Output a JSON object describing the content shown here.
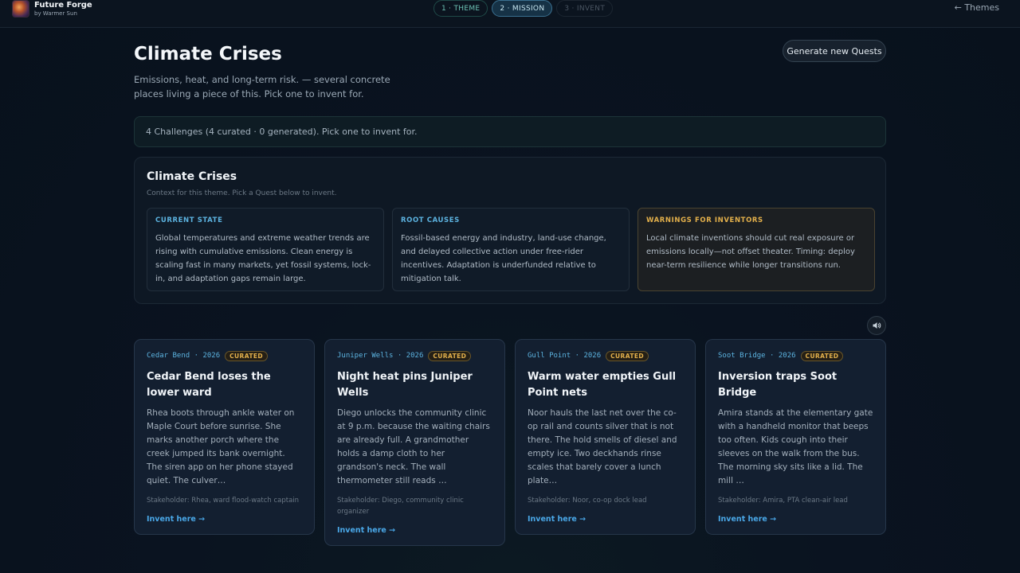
{
  "brand": {
    "title": "Future Forge",
    "subtitle": "by Warmer Sun"
  },
  "steps": [
    {
      "label": "1 · THEME",
      "state": "done"
    },
    {
      "label": "2 · MISSION",
      "state": "active"
    },
    {
      "label": "3 · INVENT",
      "state": "future"
    }
  ],
  "back_label": "← Themes",
  "header": {
    "title": "Climate Crises",
    "description": "Emissions, heat, and long-term risk. — several concrete places living a piece of this. Pick one to invent for.",
    "generate_label": "Generate new Quests"
  },
  "info_bar": "4 Challenges (4 curated · 0 generated). Pick one to invent for.",
  "context": {
    "title": "Climate Crises",
    "subtitle": "Context for this theme. Pick a Quest below to invent.",
    "cards": [
      {
        "label": "CURRENT STATE",
        "text": "Global temperatures and extreme weather trends are rising with cumulative emissions. Clean energy is scaling fast in many markets, yet fossil systems, lock-in, and adaptation gaps remain large."
      },
      {
        "label": "ROOT CAUSES",
        "text": "Fossil-based energy and industry, land-use change, and delayed collective action under free-rider incentives. Adaptation is underfunded relative to mitigation talk."
      },
      {
        "label": "WARNINGS FOR INVENTORS",
        "text": "Local climate inventions should cut real exposure or emissions locally—not offset theater. Timing: deploy near-term resilience while longer transitions run."
      }
    ]
  },
  "quests": [
    {
      "location": "Cedar Bend · 2026",
      "badge": "CURATED",
      "title": "Cedar Bend loses the lower ward",
      "body": "Rhea boots through ankle water on Maple Court before sunrise. She marks another porch where the creek jumped its bank overnight. The siren app on her phone stayed quiet. The culver…",
      "stakeholder": "Stakeholder: Rhea, ward flood-watch captain",
      "link": "Invent here →"
    },
    {
      "location": "Juniper Wells · 2026",
      "badge": "CURATED",
      "title": "Night heat pins Juniper Wells",
      "body": "Diego unlocks the community clinic at 9 p.m. because the waiting chairs are already full. A grandmother holds a damp cloth to her grandson's neck. The wall thermometer still reads …",
      "stakeholder": "Stakeholder: Diego, community clinic organizer",
      "link": "Invent here →"
    },
    {
      "location": "Gull Point · 2026",
      "badge": "CURATED",
      "title": "Warm water empties Gull Point nets",
      "body": "Noor hauls the last net over the co-op rail and counts silver that is not there. The hold smells of diesel and empty ice. Two deckhands rinse scales that barely cover a lunch plate…",
      "stakeholder": "Stakeholder: Noor, co-op dock lead",
      "link": "Invent here →"
    },
    {
      "location": "Soot Bridge · 2026",
      "badge": "CURATED",
      "title": "Inversion traps Soot Bridge",
      "body": "Amira stands at the elementary gate with a handheld monitor that beeps too often. Kids cough into their sleeves on the walk from the bus. The morning sky sits like a lid. The mill …",
      "stakeholder": "Stakeholder: Amira, PTA clean-air lead",
      "link": "Invent here →"
    }
  ]
}
